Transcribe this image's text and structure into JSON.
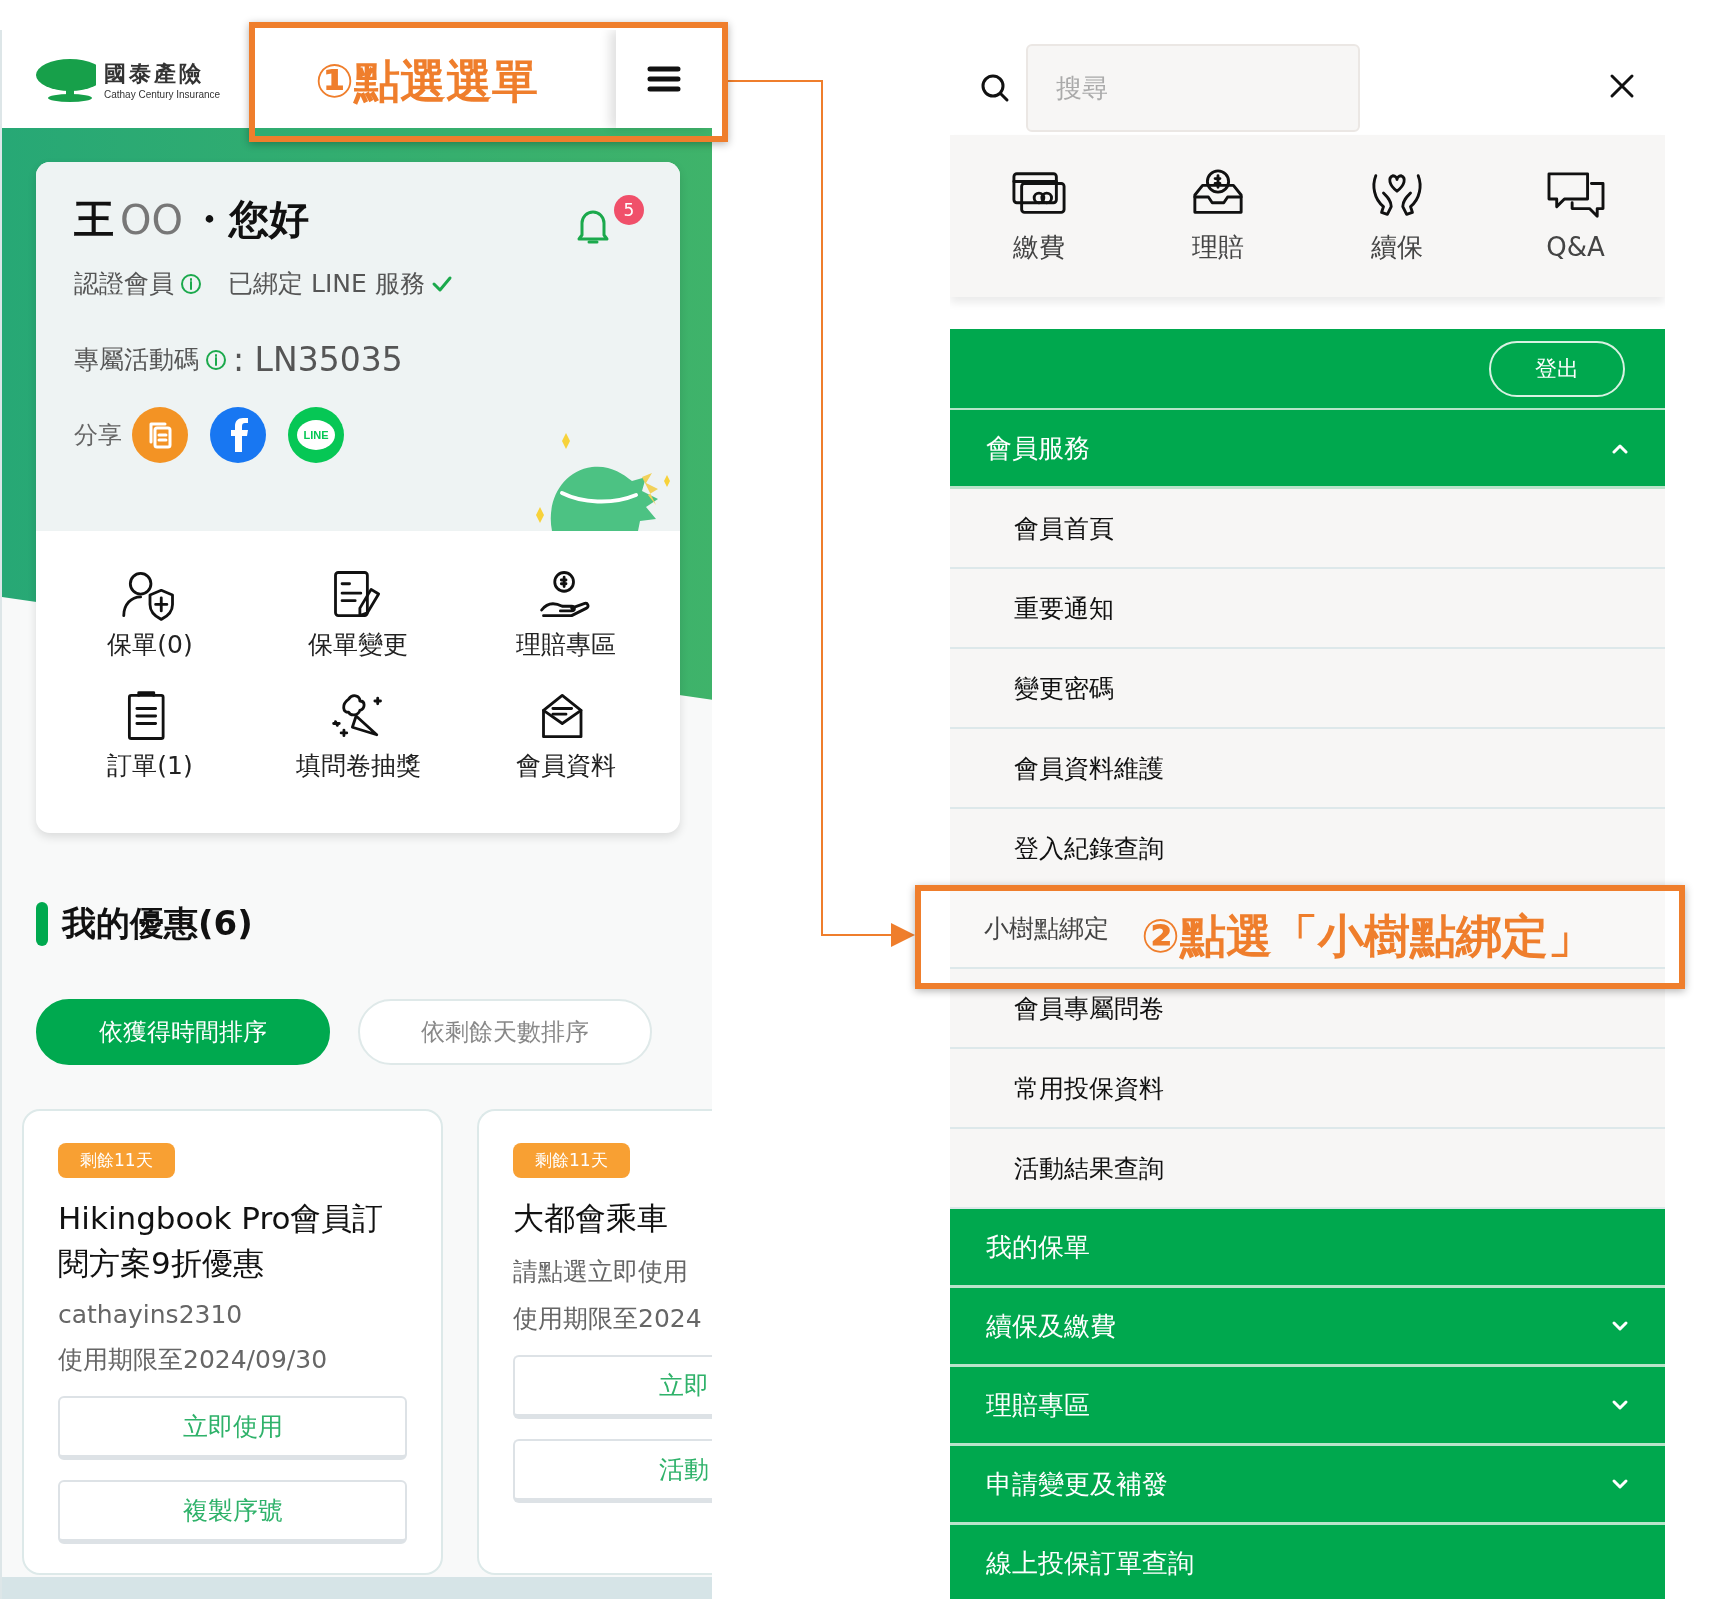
{
  "header": {
    "logo_title": "國泰產險",
    "logo_subtitle": "Cathay Century Insurance"
  },
  "profile": {
    "surname": "王",
    "masked_name": "OO",
    "greeting": "・您好",
    "notification_count": "5",
    "member_status": "認證會員",
    "line_status": "已綁定 LINE 服務",
    "line_bound": true,
    "promo_label": "專屬活動碼",
    "promo_code": ": LN35035",
    "share_label": "分享",
    "share_buttons": [
      {
        "kind": "copy"
      },
      {
        "kind": "facebook"
      },
      {
        "kind": "line",
        "label": "LINE"
      }
    ]
  },
  "shortcuts": [
    {
      "kind": "policy",
      "label": "保單(0)"
    },
    {
      "kind": "edit",
      "label": "保單變更"
    },
    {
      "kind": "claim",
      "label": "理賠專區"
    },
    {
      "kind": "order",
      "label": "訂單(1)"
    },
    {
      "kind": "party",
      "label": "填問卷抽獎"
    },
    {
      "kind": "mail",
      "label": "會員資料"
    }
  ],
  "offers": {
    "title": "我的優惠(6)",
    "sort_options": [
      {
        "label": "依獲得時間排序",
        "selected": true
      },
      {
        "label": "依剩餘天數排序",
        "selected": false
      }
    ],
    "cards": [
      {
        "badge": "剩餘11天",
        "title": "Hikingbook Pro會員訂閱方案9折優惠",
        "lines": [
          "cathayins2310",
          "使用期限至2024/09/30"
        ],
        "buttons": [
          "立即使用",
          "複製序號"
        ]
      },
      {
        "badge": "剩餘11天",
        "title": "大都會乘車",
        "lines": [
          "請點選立即使用",
          "使用期限至2024"
        ],
        "buttons": [
          "立即",
          "活動"
        ]
      }
    ]
  },
  "menu": {
    "search": {
      "placeholder": "搜尋"
    },
    "quick_links": [
      {
        "kind": "payment",
        "label": "繳費"
      },
      {
        "kind": "claim",
        "label": "理賠"
      },
      {
        "kind": "renewal",
        "label": "續保"
      },
      {
        "kind": "qa",
        "label": "Q&A"
      }
    ],
    "logout": "登出",
    "sections": [
      {
        "kind": "group",
        "label": "會員服務",
        "expanded": true,
        "children": [
          {
            "label": "會員首頁",
            "selected": false
          },
          {
            "label": "重要通知",
            "selected": false
          },
          {
            "label": "變更密碼",
            "selected": false
          },
          {
            "label": "會員資料維護",
            "selected": false
          },
          {
            "label": "登入紀錄查詢",
            "selected": false
          },
          {
            "label": "小樹點綁定",
            "selected": true
          },
          {
            "label": "會員專屬問卷",
            "selected": false
          },
          {
            "label": "常用投保資料",
            "selected": false
          },
          {
            "label": "活動結果查詢",
            "selected": false
          }
        ]
      },
      {
        "kind": "link",
        "label": "我的保單"
      },
      {
        "kind": "group",
        "label": "續保及繳費",
        "expanded": false
      },
      {
        "kind": "group",
        "label": "理賠專區",
        "expanded": false
      },
      {
        "kind": "group",
        "label": "申請變更及補發",
        "expanded": false
      },
      {
        "kind": "link",
        "label": "線上投保訂單查詢"
      }
    ]
  },
  "annotations": [
    {
      "text": "①點選選單"
    },
    {
      "text": "②點選「小樹點綁定」"
    }
  ]
}
